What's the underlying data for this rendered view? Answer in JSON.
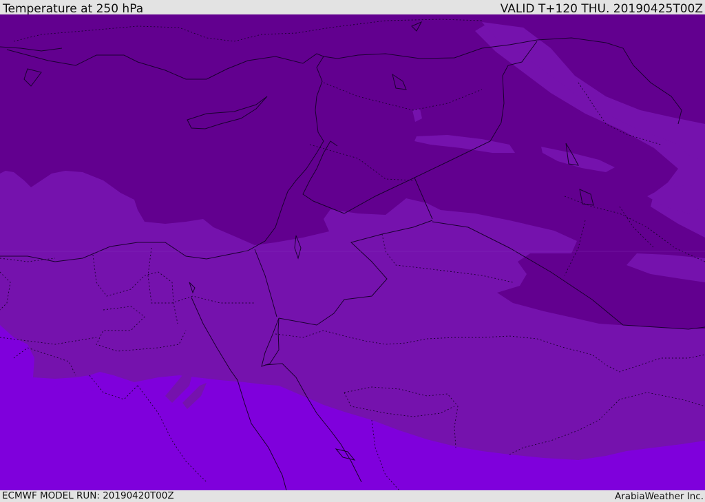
{
  "header": {
    "title": "Temperature at 250 hPa",
    "valid": "VALID T+120 THU. 20190425T00Z"
  },
  "footer": {
    "model_run": "ECMWF MODEL RUN: 20190420T00Z",
    "credit": "ArabiaWeather Inc."
  },
  "map": {
    "field": "temperature",
    "pressure_level": "250 hPa",
    "colors": {
      "coldest_band": "#62008f",
      "middle_band": "#7512ad",
      "warm_band": "#7f00dc",
      "border_lines": "#1a0030"
    }
  }
}
